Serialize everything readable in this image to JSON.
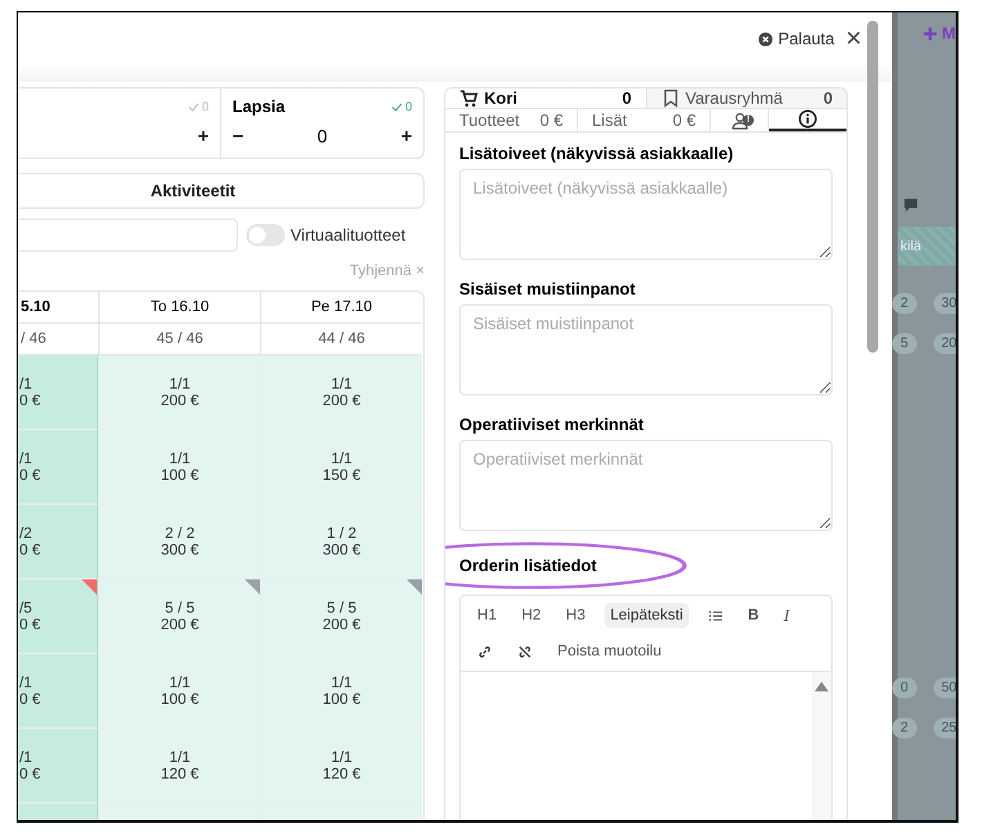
{
  "header": {
    "reset_label": "Palauta",
    "close": "×"
  },
  "side_button": {
    "label": "M"
  },
  "guests": [
    {
      "checked_count": "0",
      "confirmed": false,
      "plus": "+"
    },
    {
      "label": "Lapsia",
      "checked_count": "0",
      "confirmed": true,
      "minus": "−",
      "value": "0",
      "plus": "+"
    }
  ],
  "activities_button": "Aktiviteetit",
  "virtual_toggle": {
    "label": "Virtuaalituotteet",
    "on": false
  },
  "clear_filter": {
    "label": "Tyhjennä",
    "icon": "×"
  },
  "calendar": {
    "columns": [
      {
        "header": "5.10",
        "capacity": "/ 46",
        "selected": true
      },
      {
        "header": "To 16.10",
        "capacity": "45 / 46",
        "selected": false
      },
      {
        "header": "Pe 17.10",
        "capacity": "44 / 46",
        "selected": false
      }
    ],
    "rows": [
      {
        "cells": [
          {
            "count": "/1",
            "price": "0 €"
          },
          {
            "count": "1/1",
            "price": "200 €"
          },
          {
            "count": "1/1",
            "price": "200 €"
          }
        ]
      },
      {
        "cells": [
          {
            "count": "/1",
            "price": "0 €"
          },
          {
            "count": "1/1",
            "price": "100 €"
          },
          {
            "count": "1/1",
            "price": "150 €"
          }
        ]
      },
      {
        "cells": [
          {
            "count": "/2",
            "price": "0 €"
          },
          {
            "count": "2 / 2",
            "price": "300 €"
          },
          {
            "count": "1 / 2",
            "price": "300 €"
          }
        ]
      },
      {
        "cells": [
          {
            "count": "/5",
            "price": "0 €",
            "flag": {
              "color": "#f26c6c"
            }
          },
          {
            "count": "5 / 5",
            "price": "200 €",
            "flag": {
              "color": "#9aa1a6"
            }
          },
          {
            "count": "5 / 5",
            "price": "200 €",
            "flag": {
              "color": "#9aa1a6"
            }
          }
        ]
      },
      {
        "cells": [
          {
            "count": "/1",
            "price": "0 €"
          },
          {
            "count": "1/1",
            "price": "100 €"
          },
          {
            "count": "1/1",
            "price": "100 €"
          }
        ]
      },
      {
        "cells": [
          {
            "count": "/1",
            "price": "0 €"
          },
          {
            "count": "1/1",
            "price": "120 €"
          },
          {
            "count": "1/1",
            "price": "120 €"
          }
        ]
      }
    ]
  },
  "cart_tabs": [
    {
      "kind": "cart",
      "label": "Kori",
      "count": "0",
      "selected": true
    },
    {
      "kind": "bookmark",
      "label": "Varausryhmä",
      "count": "0",
      "selected": false
    }
  ],
  "sub_tabs": [
    {
      "kind": "text",
      "label": "Tuotteet",
      "value": "0 €",
      "selected": false
    },
    {
      "kind": "text",
      "label": "Lisät",
      "value": "0 €",
      "selected": false
    },
    {
      "kind": "customer",
      "badge": "!",
      "selected": false
    },
    {
      "kind": "info",
      "selected": true
    }
  ],
  "fields": [
    {
      "label": "Lisätoiveet (näkyvissä asiakkaalle)",
      "placeholder": "Lisätoiveet (näkyvissä asiakkaalle)"
    },
    {
      "label": "Sisäiset muistiinpanot",
      "placeholder": "Sisäiset muistiinpanot"
    },
    {
      "label": "Operatiiviset merkinnät",
      "placeholder": "Operatiiviset merkinnät"
    }
  ],
  "editor": {
    "label": "Orderin lisätiedot",
    "toolbar": [
      {
        "kind": "text",
        "label": "H1",
        "selected": false
      },
      {
        "kind": "text",
        "label": "H2",
        "selected": false
      },
      {
        "kind": "text",
        "label": "H3",
        "selected": false
      },
      {
        "kind": "text",
        "label": "Leipäteksti",
        "selected": true
      },
      {
        "kind": "list",
        "selected": false
      },
      {
        "kind": "bold",
        "label": "B",
        "selected": false
      },
      {
        "kind": "italic",
        "label": "I",
        "selected": false
      },
      {
        "kind": "link",
        "selected": false
      },
      {
        "kind": "unlink",
        "selected": false
      },
      {
        "kind": "text",
        "label": "Poista muotoilu",
        "selected": false
      }
    ]
  },
  "background": {
    "band_label": "kilä",
    "pills": [
      [
        "2",
        "30"
      ],
      [
        "5",
        "20"
      ],
      [
        "0",
        "50"
      ],
      [
        "2",
        "25"
      ]
    ]
  }
}
